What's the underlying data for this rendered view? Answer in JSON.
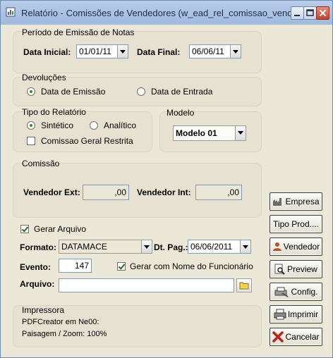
{
  "window": {
    "title": "Relatório - Comissões de Vendedores (w_ead_rel_comissao_vend)"
  },
  "periodo": {
    "title": "Período de Emissão de Notas",
    "data_inicial_label": "Data Inicial:",
    "data_inicial_value": "01/01/11",
    "data_final_label": "Data Final:",
    "data_final_value": "06/06/11"
  },
  "devolucoes": {
    "title": "Devoluções",
    "option_emissao": "Data de Emissão",
    "option_entrada": "Data de Entrada",
    "selected": "emissao"
  },
  "tipo_relatorio": {
    "title": "Tipo do Relatório",
    "option_sintetico": "Sintético",
    "option_analitico": "Analítico",
    "selected": "sintetico",
    "comissao_geral_label": "Comissao Geral Restrita",
    "comissao_geral_checked": false
  },
  "modelo": {
    "title": "Modelo",
    "value": "Modelo 01"
  },
  "comissao": {
    "title": "Comissão",
    "vendedor_ext_label": "Vendedor Ext:",
    "vendedor_ext_value": ",00",
    "vendedor_int_label": "Vendedor Int:",
    "vendedor_int_value": ",00"
  },
  "arquivo": {
    "gerar_arquivo_label": "Gerar Arquivo",
    "gerar_arquivo_checked": true,
    "formato_label": "Formato:",
    "formato_value": "DATAMACE",
    "dt_pag_label": "Dt. Pag.:",
    "dt_pag_value": "06/06/2011",
    "evento_label": "Evento:",
    "evento_value": "147",
    "gerar_nome_label": "Gerar com Nome do Funcionário",
    "gerar_nome_checked": true,
    "arquivo_label": "Arquivo:",
    "arquivo_value": ""
  },
  "impressora": {
    "title": "Impressora",
    "line1": "PDFCreator em Ne00:",
    "line2": "Paisagem / Zoom: 100%"
  },
  "buttons": {
    "empresa": "Empresa",
    "tipo_prod": "Tipo Prod....",
    "vendedor": "Vendedor",
    "preview": "Preview",
    "config": "Config.",
    "imprimir": "Imprimir",
    "cancelar": "Cancelar"
  },
  "colors": {
    "titlebar": "#a8c0e0",
    "window_bg": "#ece8d8",
    "selected_radio": "#2f8c2f",
    "cancel_icon": "#c0211a"
  },
  "icons": [
    "report-icon",
    "minimize-icon",
    "maximize-icon",
    "close-icon",
    "building-icon",
    "person-icon",
    "magnifier-icon",
    "wrench-printer-icon",
    "printer-icon",
    "red-x-icon",
    "folder-icon"
  ]
}
